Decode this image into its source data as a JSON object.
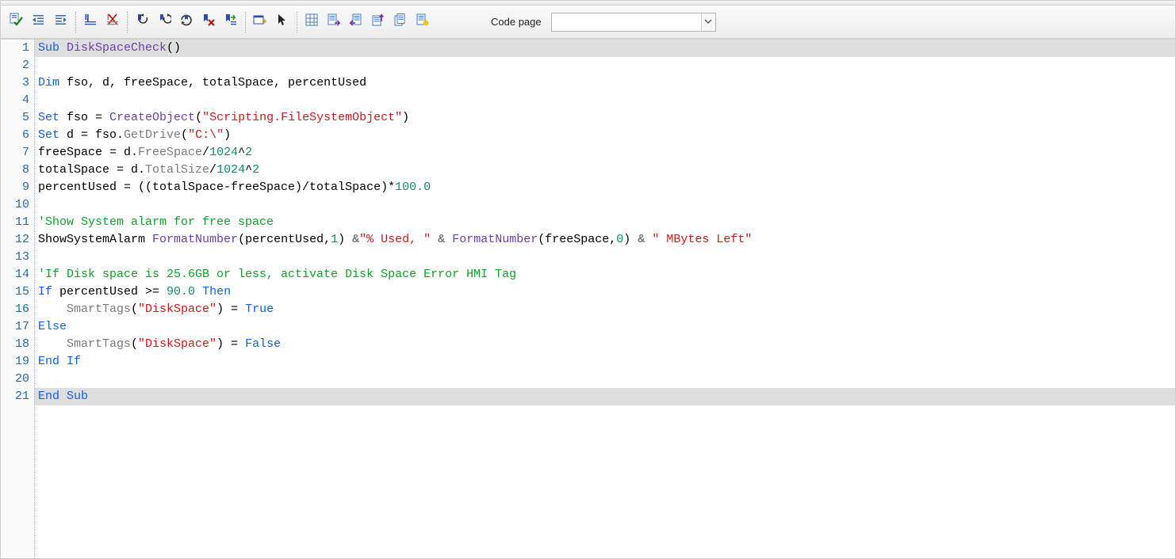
{
  "toolbar": {
    "codepage_label": "Code page",
    "codepage_value": "",
    "buttons": [
      "check-icon",
      "indent-right-icon",
      "indent-left-icon",
      "sep",
      "bookmark-toggle-icon",
      "bookmark-clear-icon",
      "sep",
      "bookmark-prev-icon",
      "bookmark-next-icon",
      "bookmark-cycle-icon",
      "bookmark-delete-icon",
      "bookmark-goto-icon",
      "sep",
      "insert-sub-icon",
      "cursor-icon",
      "sep",
      "grid-icon",
      "sheet-next-icon",
      "sheet-prev-icon",
      "sheet-up-icon",
      "sheet-copy-icon",
      "sheet-new-icon"
    ]
  },
  "code": {
    "highlighted_lines": [
      1,
      21
    ],
    "lines": [
      [
        {
          "t": "Sub ",
          "c": "kw"
        },
        {
          "t": "DiskSpaceCheck",
          "c": "fn"
        },
        {
          "t": "()"
        }
      ],
      [
        {
          "t": ""
        }
      ],
      [
        {
          "t": "Dim ",
          "c": "kw"
        },
        {
          "t": "fso, d, freeSpace, totalSpace, percentUsed"
        }
      ],
      [
        {
          "t": ""
        }
      ],
      [
        {
          "t": "Set ",
          "c": "kw"
        },
        {
          "t": "fso = "
        },
        {
          "t": "CreateObject",
          "c": "fn"
        },
        {
          "t": "("
        },
        {
          "t": "\"Scripting.FileSystemObject\"",
          "c": "str"
        },
        {
          "t": ")"
        }
      ],
      [
        {
          "t": "Set ",
          "c": "kw"
        },
        {
          "t": "d = fso."
        },
        {
          "t": "GetDrive",
          "c": "clsmem"
        },
        {
          "t": "("
        },
        {
          "t": "\"C:\\\"",
          "c": "str"
        },
        {
          "t": ")"
        }
      ],
      [
        {
          "t": "freeSpace = d."
        },
        {
          "t": "FreeSpace",
          "c": "clsmem"
        },
        {
          "t": "/"
        },
        {
          "t": "1024",
          "c": "num"
        },
        {
          "t": "^"
        },
        {
          "t": "2",
          "c": "num"
        }
      ],
      [
        {
          "t": "totalSpace = d."
        },
        {
          "t": "TotalSize",
          "c": "clsmem"
        },
        {
          "t": "/"
        },
        {
          "t": "1024",
          "c": "num"
        },
        {
          "t": "^"
        },
        {
          "t": "2",
          "c": "num"
        }
      ],
      [
        {
          "t": "percentUsed = ((totalSpace-freeSpace)/totalSpace)*"
        },
        {
          "t": "100.0",
          "c": "num"
        }
      ],
      [
        {
          "t": ""
        }
      ],
      [
        {
          "t": "'Show System alarm for free space",
          "c": "cmt"
        }
      ],
      [
        {
          "t": "ShowSystemAlarm "
        },
        {
          "t": "FormatNumber",
          "c": "fn"
        },
        {
          "t": "(percentUsed,"
        },
        {
          "t": "1",
          "c": "num"
        },
        {
          "t": ") "
        },
        {
          "t": "&",
          "c": "op"
        },
        {
          "t": "\"% Used, \"",
          "c": "str"
        },
        {
          "t": " "
        },
        {
          "t": "&",
          "c": "op"
        },
        {
          "t": " "
        },
        {
          "t": "FormatNumber",
          "c": "fn"
        },
        {
          "t": "(freeSpace,"
        },
        {
          "t": "0",
          "c": "num"
        },
        {
          "t": ") "
        },
        {
          "t": "&",
          "c": "op"
        },
        {
          "t": " "
        },
        {
          "t": "\" MBytes Left\"",
          "c": "str"
        }
      ],
      [
        {
          "t": ""
        }
      ],
      [
        {
          "t": "'If Disk space is 25.6GB or less, activate Disk Space Error HMI Tag",
          "c": "cmt"
        }
      ],
      [
        {
          "t": "If ",
          "c": "kw"
        },
        {
          "t": "percentUsed >= "
        },
        {
          "t": "90.0",
          "c": "num"
        },
        {
          "t": " "
        },
        {
          "t": "Then",
          "c": "kw"
        }
      ],
      [
        {
          "t": "    "
        },
        {
          "t": "SmartTags",
          "c": "clsmem"
        },
        {
          "t": "("
        },
        {
          "t": "\"DiskSpace\"",
          "c": "str"
        },
        {
          "t": ") = "
        },
        {
          "t": "True",
          "c": "kw"
        }
      ],
      [
        {
          "t": "Else",
          "c": "kw"
        }
      ],
      [
        {
          "t": "    "
        },
        {
          "t": "SmartTags",
          "c": "clsmem"
        },
        {
          "t": "("
        },
        {
          "t": "\"DiskSpace\"",
          "c": "str"
        },
        {
          "t": ") = "
        },
        {
          "t": "False",
          "c": "kw"
        }
      ],
      [
        {
          "t": "End If",
          "c": "kw"
        }
      ],
      [
        {
          "t": ""
        }
      ],
      [
        {
          "t": "End Sub",
          "c": "kw"
        }
      ]
    ]
  }
}
